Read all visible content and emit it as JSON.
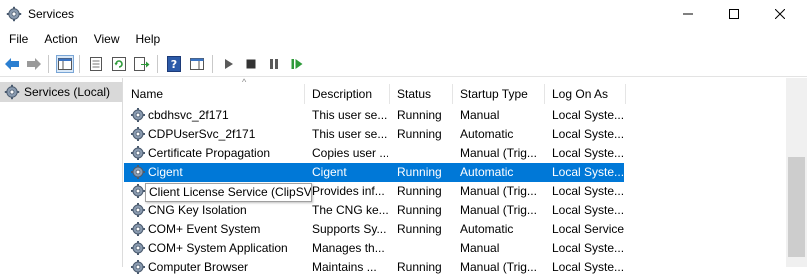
{
  "window": {
    "title": "Services"
  },
  "menu": [
    "File",
    "Action",
    "View",
    "Help"
  ],
  "tree": {
    "selected": "Services (Local)"
  },
  "columns": [
    "Name",
    "Description",
    "Status",
    "Startup Type",
    "Log On As"
  ],
  "services": [
    {
      "name": "cbdhsvc_2f171",
      "description": "This user se...",
      "status": "Running",
      "startup": "Manual",
      "logon": "Local Syste..."
    },
    {
      "name": "CDPUserSvc_2f171",
      "description": "This user se...",
      "status": "Running",
      "startup": "Automatic",
      "logon": "Local Syste..."
    },
    {
      "name": "Certificate Propagation",
      "description": "Copies user ...",
      "status": "",
      "startup": "Manual (Trig...",
      "logon": "Local Syste..."
    },
    {
      "name": "Cigent",
      "description": "Cigent",
      "status": "Running",
      "startup": "Automatic",
      "logon": "Local Syste..."
    },
    {
      "name": "Client License Service (ClipS...",
      "description": "Provides inf...",
      "status": "Running",
      "startup": "Manual (Trig...",
      "logon": "Local Syste..."
    },
    {
      "name": "CNG Key Isolation",
      "description": "The CNG ke...",
      "status": "Running",
      "startup": "Manual (Trig...",
      "logon": "Local Syste..."
    },
    {
      "name": "COM+ Event System",
      "description": "Supports Sy...",
      "status": "Running",
      "startup": "Automatic",
      "logon": "Local Service"
    },
    {
      "name": "COM+ System Application",
      "description": "Manages th...",
      "status": "",
      "startup": "Manual",
      "logon": "Local Syste..."
    },
    {
      "name": "Computer Browser",
      "description": "Maintains ...",
      "status": "Running",
      "startup": "Manual (Trig...",
      "logon": "Local Syste..."
    }
  ],
  "selected_index": 3,
  "tooltip": {
    "text": "Client License Service (ClipSVC)"
  },
  "colors": {
    "selection": "#0078d7",
    "tree_selected": "#d9d9d9"
  }
}
